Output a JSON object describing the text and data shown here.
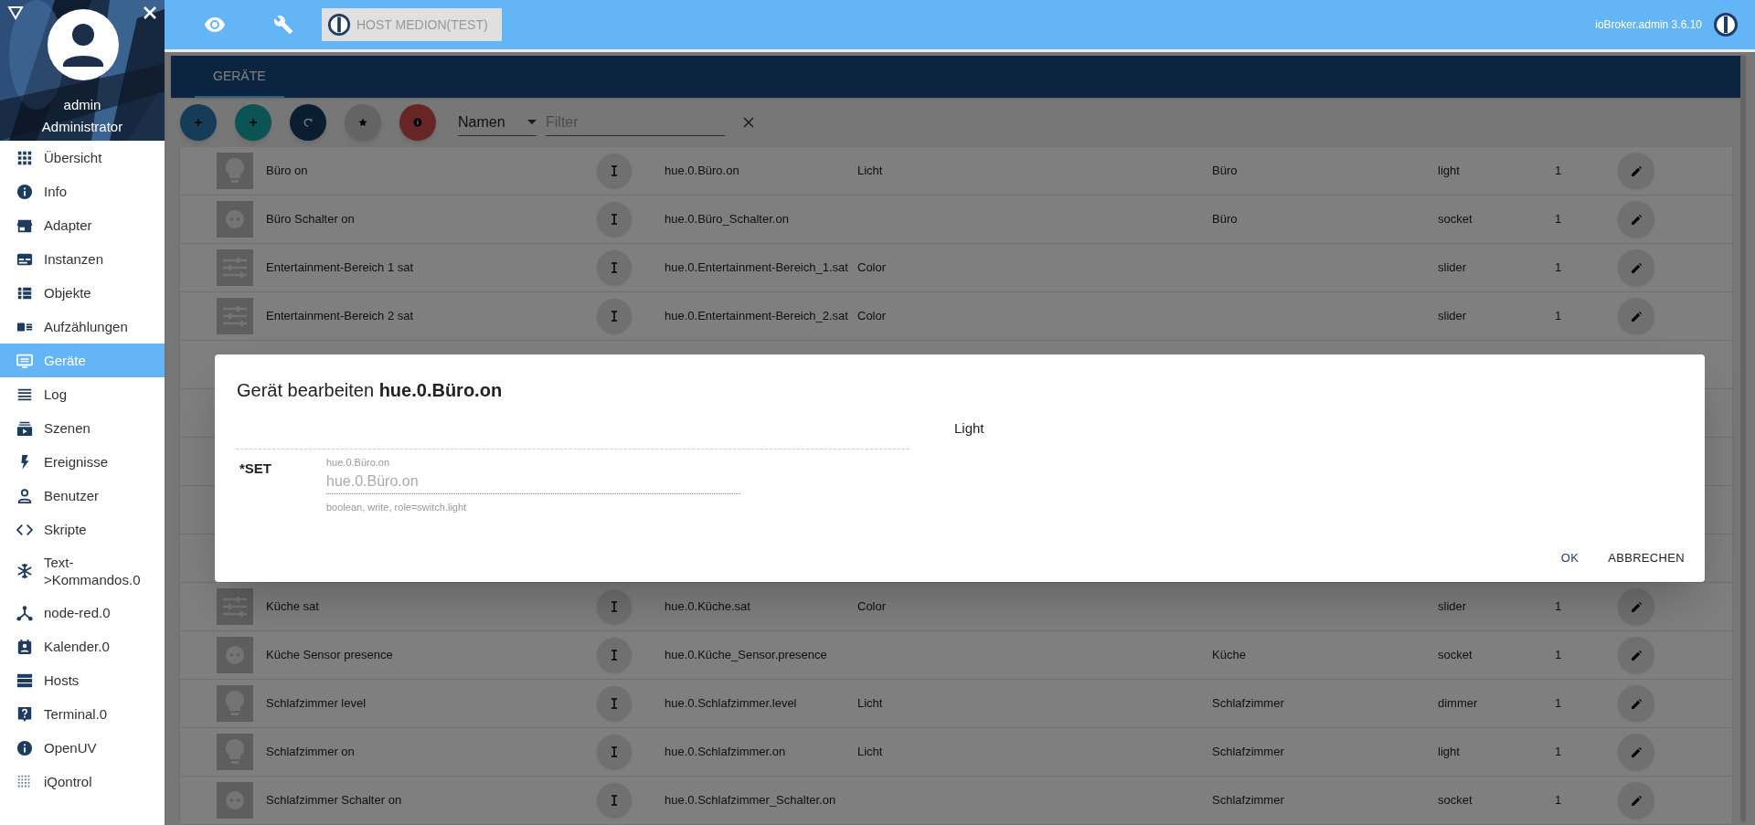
{
  "sidebar": {
    "user": "admin",
    "role": "Administrator",
    "items": [
      {
        "label": "Übersicht",
        "kind": "grid",
        "selected": false
      },
      {
        "label": "Info",
        "kind": "info",
        "selected": false
      },
      {
        "label": "Adapter",
        "kind": "store",
        "selected": false
      },
      {
        "label": "Instanzen",
        "kind": "instances",
        "selected": false
      },
      {
        "label": "Objekte",
        "kind": "list",
        "selected": false
      },
      {
        "label": "Aufzählungen",
        "kind": "enum",
        "selected": false
      },
      {
        "label": "Geräte",
        "kind": "monitor",
        "selected": true
      },
      {
        "label": "Log",
        "kind": "lines",
        "selected": false
      },
      {
        "label": "Szenen",
        "kind": "scenes",
        "selected": false
      },
      {
        "label": "Ereignisse",
        "kind": "bolt",
        "selected": false
      },
      {
        "label": "Benutzer",
        "kind": "user",
        "selected": false
      },
      {
        "label": "Skripte",
        "kind": "code",
        "selected": false
      },
      {
        "label": "Text->Kommandos.0",
        "kind": "snow",
        "selected": false
      },
      {
        "label": "node-red.0",
        "kind": "nodes",
        "selected": false
      },
      {
        "label": "Kalender.0",
        "kind": "calendar",
        "selected": false
      },
      {
        "label": "Hosts",
        "kind": "hosts",
        "selected": false
      },
      {
        "label": "Terminal.0",
        "kind": "question",
        "selected": false
      },
      {
        "label": "OpenUV",
        "kind": "info",
        "selected": false
      },
      {
        "label": "iQontrol",
        "kind": "dots",
        "selected": false
      }
    ]
  },
  "top_bar": {
    "host": "HOST MEDION(TEST)",
    "version": "ioBroker.admin 3.6.10"
  },
  "tabs": [
    {
      "label": "GERÄTE",
      "selected": true
    }
  ],
  "toolbar": {
    "buttons": [
      {
        "kind": "plus"
      },
      {
        "kind": "plus"
      },
      {
        "kind": "refresh"
      },
      {
        "kind": "star"
      },
      {
        "kind": "info"
      }
    ],
    "sort": "Namen",
    "filter_placeholder": "Filter"
  },
  "rows_top": [
    {
      "name": "Büro on",
      "kind": "bulb",
      "id": "hue.0.Büro.on",
      "function": "Licht",
      "room": "Büro",
      "type": "light",
      "count": "1"
    },
    {
      "name": "Büro Schalter on",
      "kind": "plug",
      "id": "hue.0.Büro_Schalter.on",
      "room": "Büro",
      "type": "socket",
      "count": "1"
    },
    {
      "name": "Entertainment-Bereich 1 sat",
      "kind": "sliders",
      "id": "hue.0.Entertainment-Bereich_1.sat",
      "function": "Color",
      "type": "slider",
      "count": "1"
    },
    {
      "name": "Entertainment-Bereich 2 sat",
      "kind": "sliders",
      "id": "hue.0.Entertainment-Bereich_2.sat",
      "function": "Color",
      "type": "slider",
      "count": "1"
    }
  ],
  "rows_bottom": [
    {
      "name": "Küche sat",
      "kind": "sliders",
      "id": "hue.0.Küche.sat",
      "function": "Color",
      "type": "slider",
      "count": "1"
    },
    {
      "name": "Küche Sensor presence",
      "kind": "plug",
      "id": "hue.0.Küche_Sensor.presence",
      "room": "Küche",
      "type": "socket",
      "count": "1"
    },
    {
      "name": "Schlafzimmer level",
      "kind": "bulb",
      "id": "hue.0.Schlafzimmer.level",
      "function": "Licht",
      "room": "Schlafzimmer",
      "type": "dimmer",
      "count": "1"
    },
    {
      "name": "Schlafzimmer on",
      "kind": "bulb",
      "id": "hue.0.Schlafzimmer.on",
      "function": "Licht",
      "room": "Schlafzimmer",
      "type": "light",
      "count": "1"
    },
    {
      "name": "Schlafzimmer Schalter on",
      "kind": "plug",
      "id": "hue.0.Schlafzimmer_Schalter.on",
      "room": "Schlafzimmer",
      "type": "socket",
      "count": "1"
    }
  ],
  "dialog": {
    "title": "Gerät bearbeiten **hue.0.Büro.on**",
    "device_type": "Light",
    "field_label": "*SET",
    "field_floating_label": "hue.0.Büro.on",
    "field_placeholder": "hue.0.Büro.on",
    "field_helper": "boolean, write, role=switch.light",
    "buttons": [
      "OK",
      "ABBRECHEN"
    ]
  }
}
